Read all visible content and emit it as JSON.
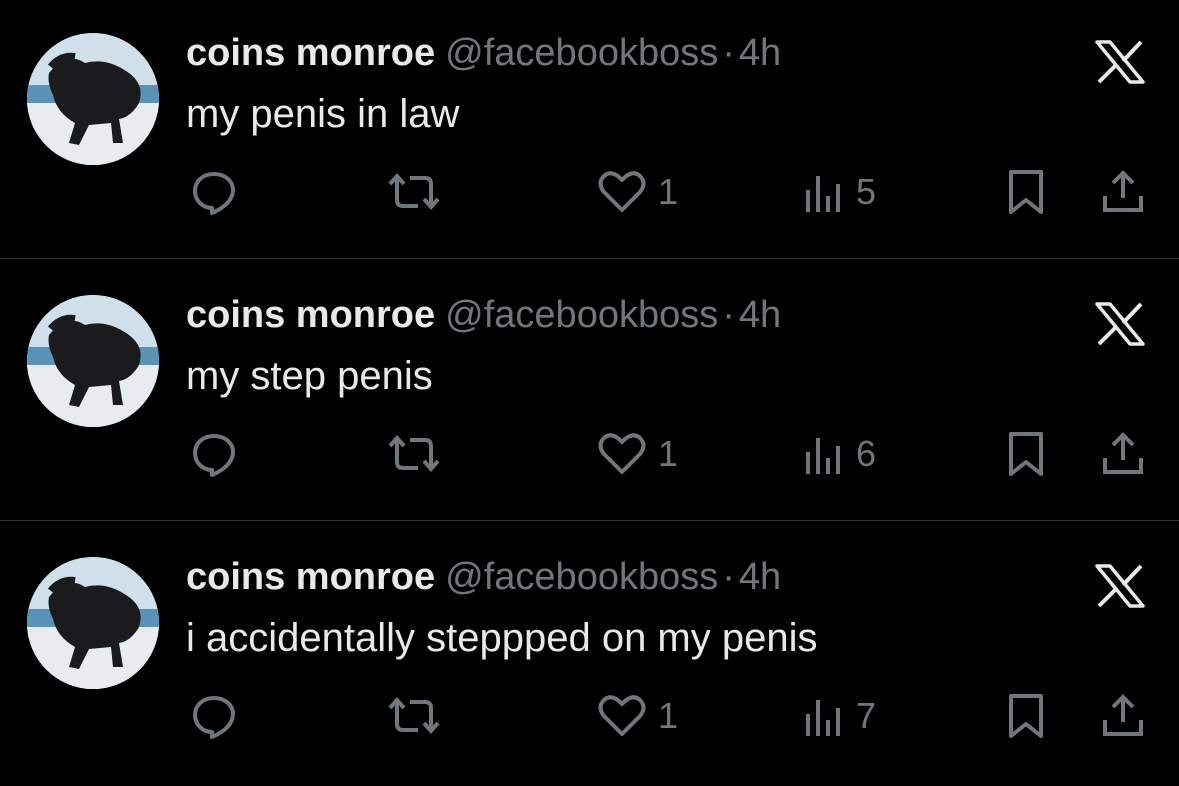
{
  "tweets": [
    {
      "display_name": "coins monroe",
      "handle": "@facebookboss",
      "separator": "·",
      "time": "4h",
      "text": "my penis in law",
      "likes": "1",
      "views": "5"
    },
    {
      "display_name": "coins monroe",
      "handle": "@facebookboss",
      "separator": "·",
      "time": "4h",
      "text": "my step penis",
      "likes": "1",
      "views": "6"
    },
    {
      "display_name": "coins monroe",
      "handle": "@facebookboss",
      "separator": "·",
      "time": "4h",
      "text": "i accidentally steppped on my penis",
      "likes": "1",
      "views": "7"
    }
  ],
  "icons": {
    "platform": "x-logo-icon",
    "reply": "reply-icon",
    "retweet": "retweet-icon",
    "like": "heart-icon",
    "views": "views-icon",
    "bookmark": "bookmark-icon",
    "share": "share-icon"
  },
  "colors": {
    "background": "#000000",
    "text_primary": "#e7e9ea",
    "text_secondary": "#71767b",
    "divider": "#2f3336"
  }
}
